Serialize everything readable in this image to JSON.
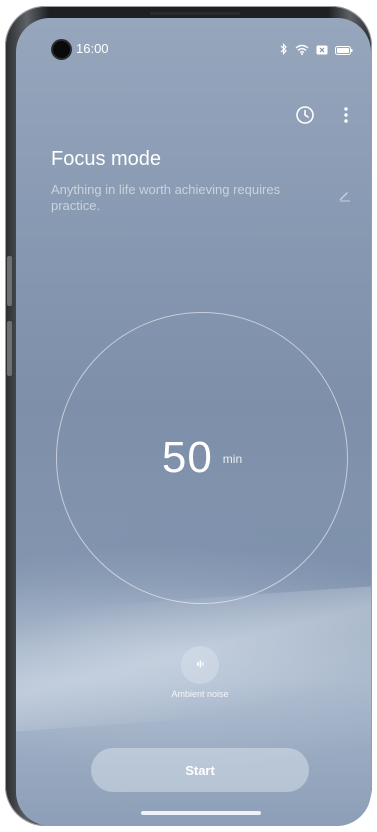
{
  "status_bar": {
    "time": "16:00",
    "icons": [
      "bluetooth-icon",
      "wifi-icon",
      "sim-off-icon",
      "battery-icon"
    ]
  },
  "toolbar": {
    "history_icon": "clock-icon",
    "more_icon": "more-vertical-icon"
  },
  "header": {
    "title": "Focus mode",
    "subtitle": "Anything in life worth achieving requires practice.",
    "edit_icon": "pencil-icon"
  },
  "timer": {
    "value": "50",
    "unit": "min"
  },
  "ambient": {
    "icon": "sound-wave-icon",
    "label": "Ambient noise"
  },
  "actions": {
    "start_label": "Start"
  },
  "colors": {
    "background": "#8a9bb4",
    "text": "#ffffff"
  }
}
